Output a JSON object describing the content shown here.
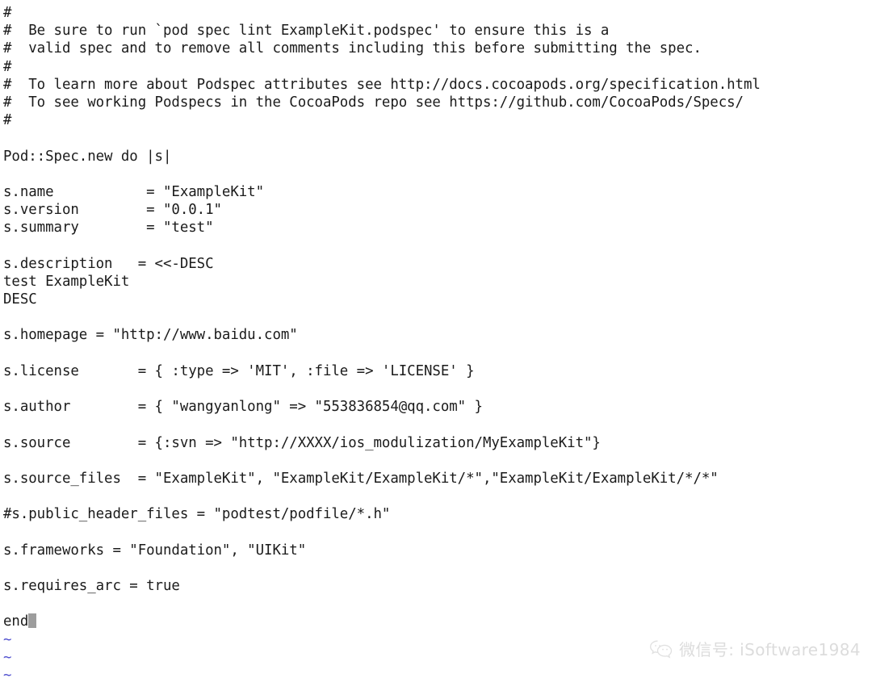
{
  "editor": {
    "app": "vim",
    "filename": "ExampleKit.podspec",
    "background_color": "#ffffff",
    "text_color": "#1b1b1b",
    "tilde_color": "#4f4fcf",
    "cursor_color": "#9d9d9d",
    "lines": [
      "#",
      "#  Be sure to run `pod spec lint ExampleKit.podspec' to ensure this is a",
      "#  valid spec and to remove all comments including this before submitting the spec.",
      "#",
      "#  To learn more about Podspec attributes see http://docs.cocoapods.org/specification.html",
      "#  To see working Podspecs in the CocoaPods repo see https://github.com/CocoaPods/Specs/",
      "#",
      "",
      "Pod::Spec.new do |s|",
      "",
      "s.name           = \"ExampleKit\"",
      "s.version        = \"0.0.1\"",
      "s.summary        = \"test\"",
      "",
      "s.description   = <<-DESC",
      "test ExampleKit",
      "DESC",
      "",
      "s.homepage = \"http://www.baidu.com\"",
      "",
      "s.license       = { :type => 'MIT', :file => 'LICENSE' }",
      "",
      "s.author        = { \"wangyanlong\" => \"553836854@qq.com\" }",
      "",
      "s.source        = {:svn => \"http://XXXX/ios_modulization/MyExampleKit\"}",
      "",
      "s.source_files  = \"ExampleKit\", \"ExampleKit/ExampleKit/*\",\"ExampleKit/ExampleKit/*/*\"",
      "",
      "#s.public_header_files = \"podtest/podfile/*.h\"",
      "",
      "s.frameworks = \"Foundation\", \"UIKit\"",
      "",
      "s.requires_arc = true",
      ""
    ],
    "last_line": "end",
    "tildes": [
      "~",
      "~",
      "~"
    ]
  },
  "watermark": {
    "icon": "wechat-icon",
    "text": "微信号: iSoftware1984"
  }
}
